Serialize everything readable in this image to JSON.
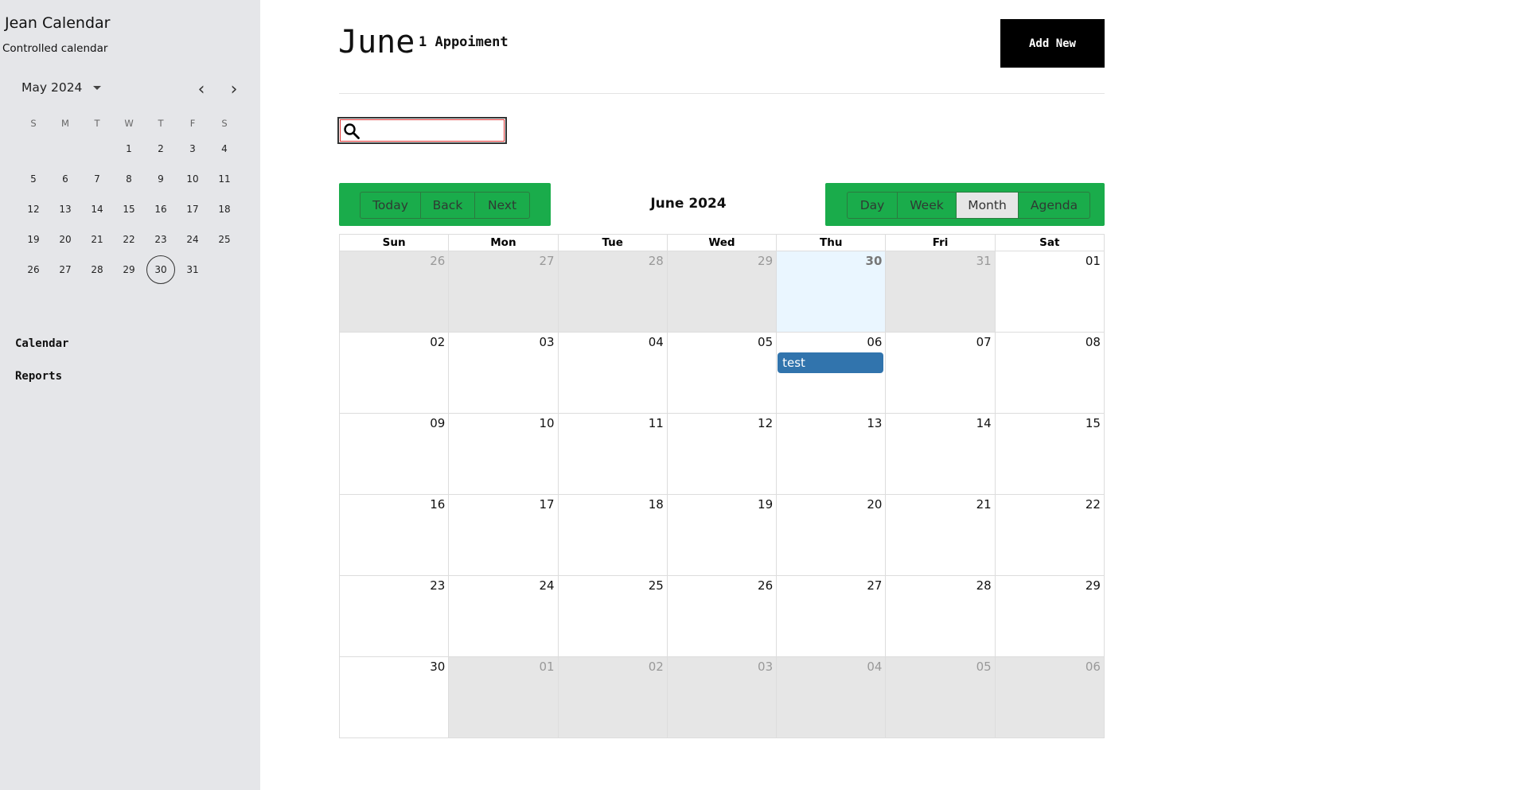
{
  "sidebar": {
    "title": "Jean Calendar",
    "subtitle": "Controlled calendar",
    "mini_calendar": {
      "month_label": "May 2024",
      "weekday_headers": [
        "S",
        "M",
        "T",
        "W",
        "T",
        "F",
        "S"
      ],
      "weeks": [
        [
          "",
          "",
          "",
          "1",
          "2",
          "3",
          "4"
        ],
        [
          "5",
          "6",
          "7",
          "8",
          "9",
          "10",
          "11"
        ],
        [
          "12",
          "13",
          "14",
          "15",
          "16",
          "17",
          "18"
        ],
        [
          "19",
          "20",
          "21",
          "22",
          "23",
          "24",
          "25"
        ],
        [
          "26",
          "27",
          "28",
          "29",
          "30",
          "31",
          ""
        ]
      ],
      "selected_day": "30"
    },
    "nav": [
      {
        "label": "Calendar"
      },
      {
        "label": "Reports"
      }
    ]
  },
  "header": {
    "title": "June",
    "count": "1 Appoiment",
    "add_button": "Add New"
  },
  "search": {
    "placeholder": "",
    "value": ""
  },
  "toolbar": {
    "nav_buttons": [
      "Today",
      "Back",
      "Next"
    ],
    "label": "June 2024",
    "views": [
      "Day",
      "Week",
      "Month",
      "Agenda"
    ],
    "active_view": "Month"
  },
  "month_grid": {
    "headers": [
      "Sun",
      "Mon",
      "Tue",
      "Wed",
      "Thu",
      "Fri",
      "Sat"
    ],
    "weeks": [
      [
        {
          "d": "26",
          "off": true
        },
        {
          "d": "27",
          "off": true
        },
        {
          "d": "28",
          "off": true
        },
        {
          "d": "29",
          "off": true
        },
        {
          "d": "30",
          "off": false,
          "today": true
        },
        {
          "d": "31",
          "off": true
        },
        {
          "d": "01",
          "off": false
        }
      ],
      [
        {
          "d": "02"
        },
        {
          "d": "03"
        },
        {
          "d": "04"
        },
        {
          "d": "05"
        },
        {
          "d": "06",
          "event": "test"
        },
        {
          "d": "07"
        },
        {
          "d": "08"
        }
      ],
      [
        {
          "d": "09"
        },
        {
          "d": "10"
        },
        {
          "d": "11"
        },
        {
          "d": "12"
        },
        {
          "d": "13"
        },
        {
          "d": "14"
        },
        {
          "d": "15"
        }
      ],
      [
        {
          "d": "16"
        },
        {
          "d": "17"
        },
        {
          "d": "18"
        },
        {
          "d": "19"
        },
        {
          "d": "20"
        },
        {
          "d": "21"
        },
        {
          "d": "22"
        }
      ],
      [
        {
          "d": "23"
        },
        {
          "d": "24"
        },
        {
          "d": "25"
        },
        {
          "d": "26"
        },
        {
          "d": "27"
        },
        {
          "d": "28"
        },
        {
          "d": "29"
        }
      ],
      [
        {
          "d": "30"
        },
        {
          "d": "01",
          "off": true
        },
        {
          "d": "02",
          "off": true
        },
        {
          "d": "03",
          "off": true
        },
        {
          "d": "04",
          "off": true
        },
        {
          "d": "05",
          "off": true
        },
        {
          "d": "06",
          "off": true
        }
      ]
    ]
  },
  "colors": {
    "toolbar_green": "#1aac4b",
    "event_blue": "#3174ad",
    "sidebar_bg": "#e5e6e9"
  }
}
